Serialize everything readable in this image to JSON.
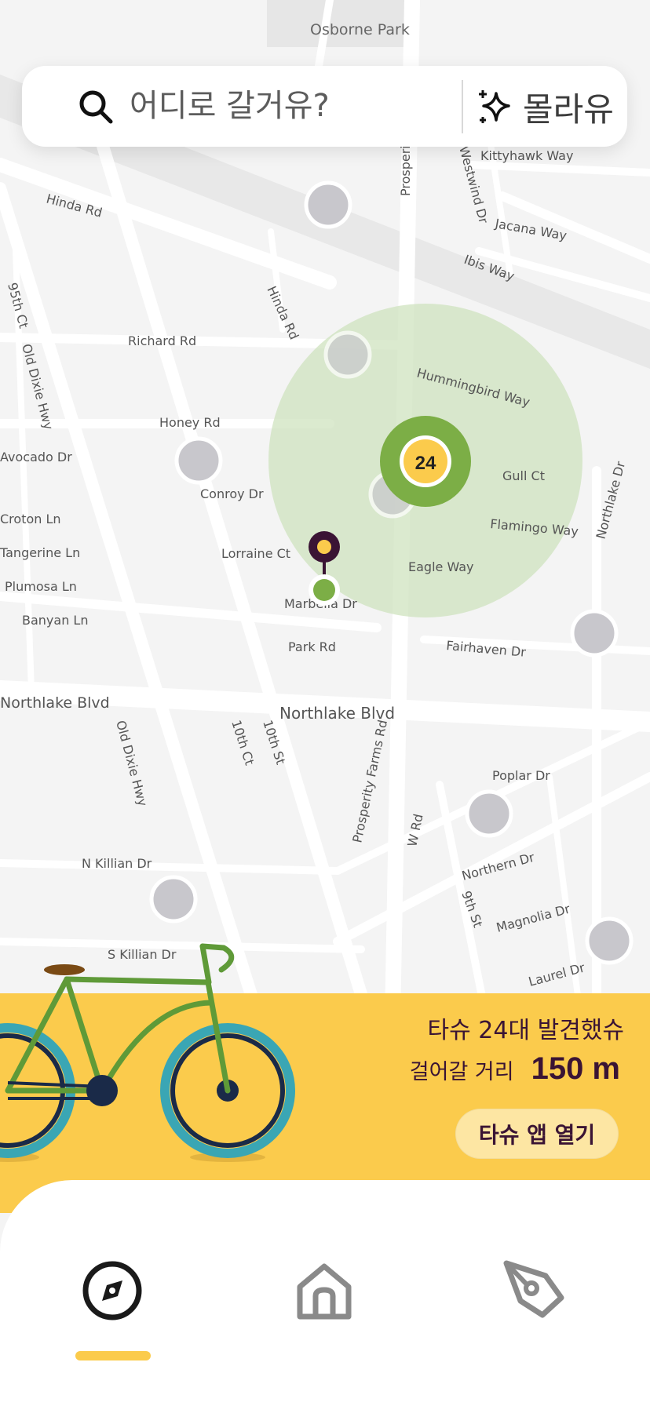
{
  "map": {
    "street_labels": [
      "Osborne Park",
      "Prosperity Farms Rd",
      "Kittyhawk Way",
      "Westwind Dr",
      "Jacana Way",
      "Ibis Way",
      "Hinda Rd",
      "Hinda Rd",
      "95th Ct",
      "Old Dixie Hwy",
      "Richard Rd",
      "Hummingbird Way",
      "Honey Rd",
      "Conroy Dr",
      "Gull Ct",
      "Northlake Dr",
      "Flamingo Way",
      "Croton Ln",
      "Tangerine Ln",
      "Plumosa Ln",
      "Banyan Ln",
      "Lorraine Ct",
      "Eagle Way",
      "Marbella Dr",
      "Park Rd",
      "Fairhaven Dr",
      "Northlake Blvd",
      "Northlake Blvd",
      "Old Dixie Hwy",
      "10th Ct",
      "10th St",
      "Prosperity Farms Rd",
      "Poplar Dr",
      "W Rd",
      "Northern Dr",
      "9th St",
      "Magnolia Dr",
      "N Killian Dr",
      "S Killian Dr",
      "Laurel Dr",
      "Avocado Dr"
    ],
    "cluster_count": "24",
    "colors": {
      "zone": "#cfe3bf",
      "cluster_green": "#7cae46",
      "cluster_yellow": "#fbcb4c",
      "marker_gray": "#c8c7cc",
      "pin_purple": "#3a1434"
    }
  },
  "search": {
    "placeholder": "어디로 갈거유?",
    "icon": "search-icon",
    "ai_label": "몰라유",
    "ai_icon": "sparkle-icon"
  },
  "info": {
    "found_text": "타슈 24대 발견했슈",
    "distance_label": "걸어갈 거리",
    "distance_value": "150 m",
    "open_app_label": "타슈 앱 열기",
    "accent": "#fbcb4c",
    "text_color": "#3a1434"
  },
  "nav": {
    "items": [
      {
        "icon": "compass-icon",
        "active": true
      },
      {
        "icon": "home-icon",
        "active": false
      },
      {
        "icon": "pen-icon",
        "active": false
      }
    ]
  }
}
